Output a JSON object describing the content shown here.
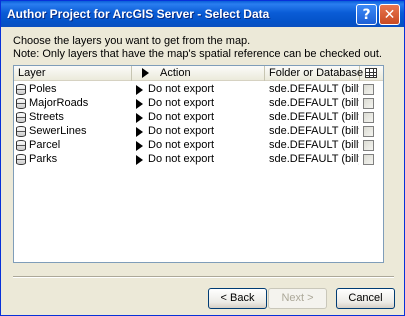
{
  "window": {
    "title": "Author Project for ArcGIS Server - Select Data",
    "help_glyph": "?",
    "close_glyph": "✕"
  },
  "instructions": {
    "line1": "Choose the layers you want to get from the map.",
    "line2": "Note: Only layers that have the map's spatial reference can be checked out."
  },
  "table": {
    "headers": {
      "layer": "Layer",
      "action": "Action",
      "folder": "Folder or Database"
    },
    "rows": [
      {
        "layer": "Poles",
        "action": "Do not export",
        "folder": "sde.DEFAULT (billy...",
        "checked": false
      },
      {
        "layer": "MajorRoads",
        "action": "Do not export",
        "folder": "sde.DEFAULT (billy...",
        "checked": false
      },
      {
        "layer": "Streets",
        "action": "Do not export",
        "folder": "sde.DEFAULT (billy...",
        "checked": false
      },
      {
        "layer": "SewerLines",
        "action": "Do not export",
        "folder": "sde.DEFAULT (billy...",
        "checked": false
      },
      {
        "layer": "Parcel",
        "action": "Do not export",
        "folder": "sde.DEFAULT (billy...",
        "checked": false
      },
      {
        "layer": "Parks",
        "action": "Do not export",
        "folder": "sde.DEFAULT (billy...",
        "checked": false
      }
    ]
  },
  "buttons": {
    "back": "< Back",
    "next": "Next >",
    "cancel": "Cancel"
  },
  "colors": {
    "titlebar": "#0a5cd6",
    "dialog_bg": "#ece9d8",
    "disabled_text": "#aca899"
  }
}
